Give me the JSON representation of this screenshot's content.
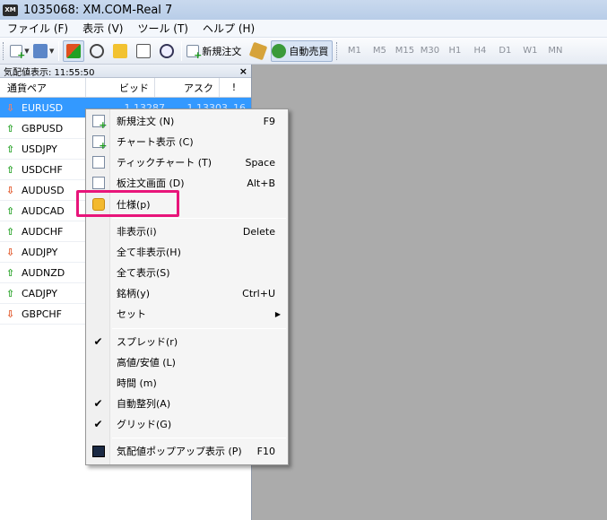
{
  "window": {
    "title": "1035068: XM.COM-Real 7",
    "logo_text": "XM"
  },
  "menubar": [
    "ファイル (F)",
    "表示 (V)",
    "ツール (T)",
    "ヘルプ (H)"
  ],
  "toolbar": {
    "new_order_label": "新規注文",
    "auto_trade_label": "自動売買",
    "timeframes": [
      "M1",
      "M5",
      "M15",
      "M30",
      "H1",
      "H4",
      "D1",
      "W1",
      "MN"
    ]
  },
  "panel": {
    "header": "気配値表示: 11:55:50",
    "close": "×",
    "columns": {
      "symbol": "通貨ペア",
      "bid": "ビッド",
      "ask": "アスク",
      "spread": "!"
    },
    "rows": [
      {
        "symbol": "EURUSD",
        "dir": "down",
        "bid": "1.13287",
        "ask": "1.13303",
        "spread": "16",
        "selected": true
      },
      {
        "symbol": "GBPUSD",
        "dir": "up"
      },
      {
        "symbol": "USDJPY",
        "dir": "up"
      },
      {
        "symbol": "USDCHF",
        "dir": "up"
      },
      {
        "symbol": "AUDUSD",
        "dir": "down"
      },
      {
        "symbol": "AUDCAD",
        "dir": "up"
      },
      {
        "symbol": "AUDCHF",
        "dir": "up"
      },
      {
        "symbol": "AUDJPY",
        "dir": "down"
      },
      {
        "symbol": "AUDNZD",
        "dir": "up"
      },
      {
        "symbol": "CADJPY",
        "dir": "up"
      },
      {
        "symbol": "GBPCHF",
        "dir": "down"
      }
    ]
  },
  "context_menu": {
    "items": [
      {
        "label": "新規注文 (N)",
        "shortcut": "F9",
        "icon": "new-order-icon"
      },
      {
        "label": "チャート表示 (C)",
        "shortcut": "",
        "icon": "chart-window-icon"
      },
      {
        "label": "ティックチャート (T)",
        "shortcut": "Space",
        "icon": "tick-chart-icon"
      },
      {
        "label": "板注文画面 (D)",
        "shortcut": "Alt+B",
        "icon": "depth-of-market-icon"
      },
      {
        "label": "仕様(p)",
        "shortcut": "",
        "icon": "specification-icon",
        "highlighted": true
      },
      {
        "label": "非表示(i)",
        "shortcut": "Delete"
      },
      {
        "label": "全て非表示(H)",
        "shortcut": ""
      },
      {
        "label": "全て表示(S)",
        "shortcut": ""
      },
      {
        "label": "銘柄(y)",
        "shortcut": "Ctrl+U"
      },
      {
        "label": "セット",
        "shortcut": "",
        "submenu": true
      },
      {
        "label": "スプレッド(r)",
        "checked": true
      },
      {
        "label": "高値/安値 (L)",
        "checked": false
      },
      {
        "label": "時間 (m)",
        "checked": false
      },
      {
        "label": "自動整列(A)",
        "checked": true
      },
      {
        "label": "グリッド(G)",
        "checked": true
      },
      {
        "label": "気配値ポップアップ表示 (P)",
        "shortcut": "F10",
        "icon": "popup-prices-icon"
      }
    ]
  },
  "colors": {
    "highlight_box": "#e8157a",
    "selection": "#3399ff",
    "up": "#22a022",
    "down": "#e05020"
  }
}
